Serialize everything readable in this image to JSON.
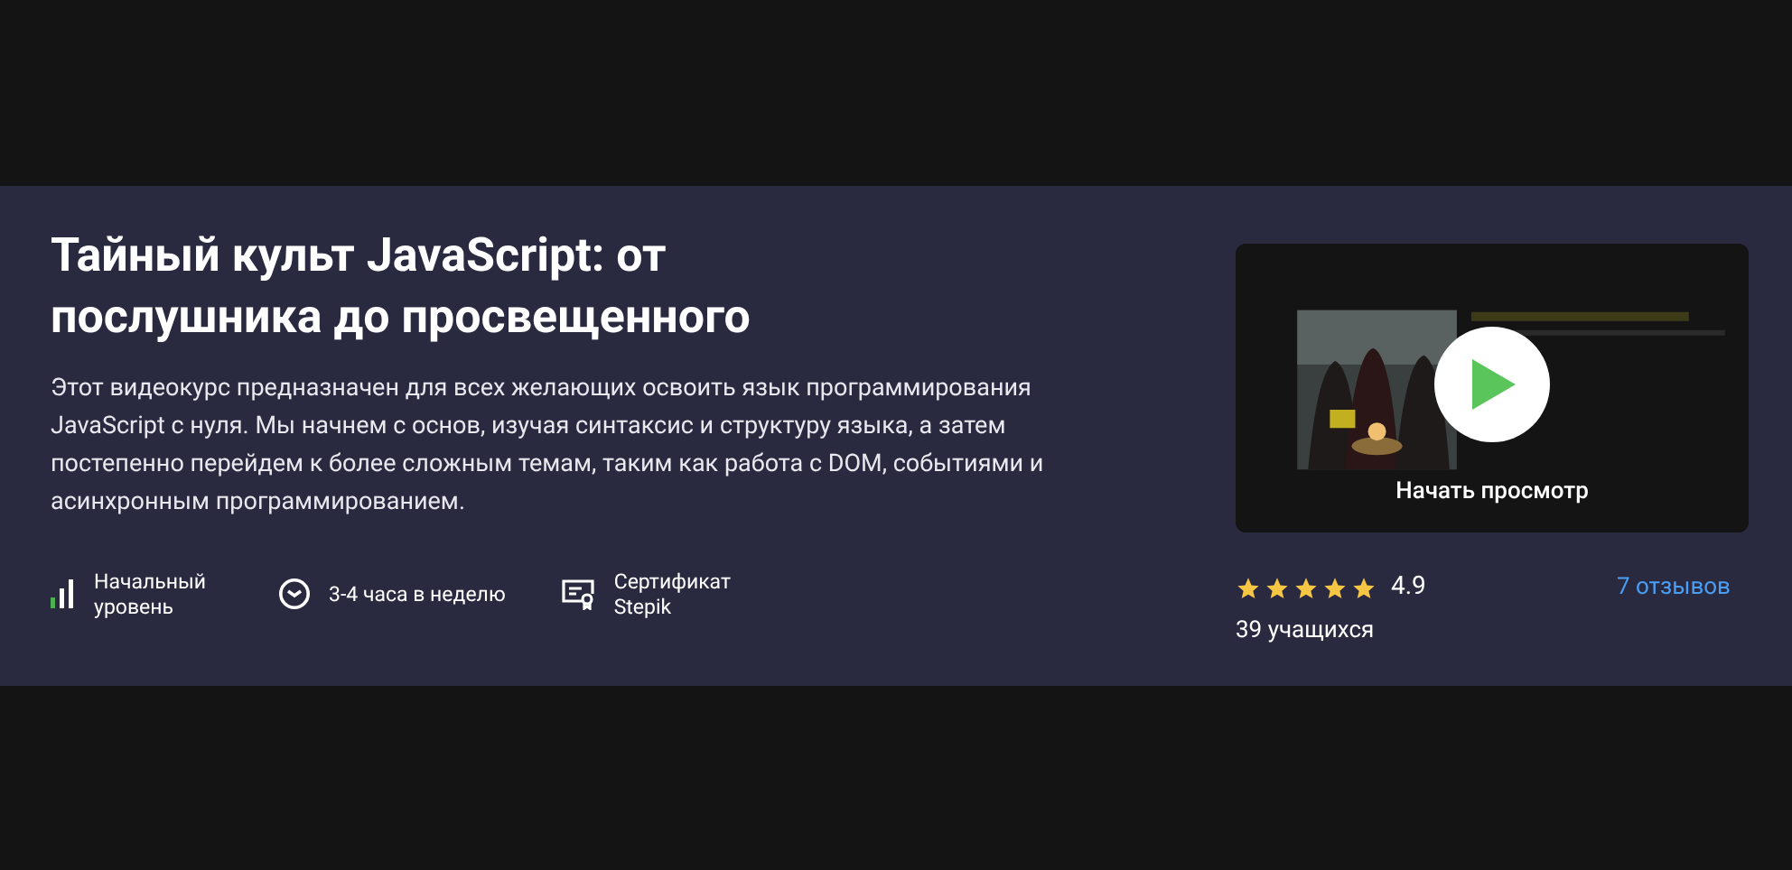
{
  "course": {
    "title": "Тайный культ JavaScript: от послушника до просвещенного",
    "description": "Этот видеокурс предназначен для всех желающих освоить язык программирования JavaScript с нуля. Мы начнем с основ, изучая синтаксис и структуру языка, а затем постепенно перейдем к более сложным темам, таким как работа с DOM, событиями и асинхронным программированием.",
    "features": [
      {
        "kind": "level",
        "text": "Начальный уровень"
      },
      {
        "kind": "time",
        "text": "3-4 часа в неделю"
      },
      {
        "kind": "certificate",
        "text": "Сертификат Stepik"
      }
    ]
  },
  "video": {
    "action": "Начать просмотр"
  },
  "rating": {
    "stars": 5,
    "score": "4.9",
    "reviews": "7 отзывов",
    "students": "39 учащихся"
  }
}
